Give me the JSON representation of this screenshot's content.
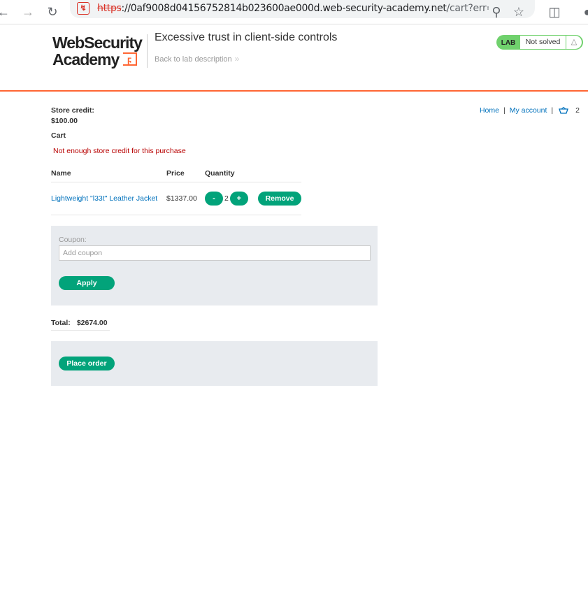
{
  "browser": {
    "url_scheme": "https",
    "url_host": "://0af9008d04156752814b023600ae000d.web-security-academy.net",
    "url_path": "/cart?err=IN..."
  },
  "lab": {
    "logo_line1": "WebSecurity",
    "logo_line2": "Academy",
    "title": "Excessive trust in client-side controls",
    "back_link": "Back to lab description",
    "status_tag": "LAB",
    "status_text": "Not solved"
  },
  "nav": {
    "home": "Home",
    "sep1": "|",
    "account": "My account",
    "sep2": "|",
    "cart_count": "2"
  },
  "store_credit": {
    "label": "Store credit:",
    "value": "$100.00"
  },
  "cart": {
    "heading": "Cart",
    "error": "Not enough store credit for this purchase",
    "columns": [
      "Name",
      "Price",
      "Quantity",
      ""
    ],
    "items": [
      {
        "name": "Lightweight \"l33t\" Leather Jacket",
        "price": "$1337.00",
        "decrement": "-",
        "quantity": "2",
        "increment": "+",
        "remove": "Remove"
      }
    ]
  },
  "coupon": {
    "label": "Coupon:",
    "placeholder": "Add coupon",
    "apply": "Apply"
  },
  "total": {
    "label": "Total:",
    "amount": "$2674.00"
  },
  "order": {
    "place_order": "Place order"
  },
  "colors": {
    "accent_green": "#02a37a",
    "brand_orange": "#ff6633",
    "link_blue": "#0071bc",
    "error_red": "#b80000",
    "status_green": "#70d16d"
  }
}
